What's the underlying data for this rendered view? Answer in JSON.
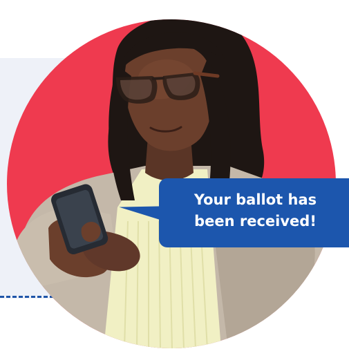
{
  "colors": {
    "accent_circle": "#ef3a4f",
    "speech_bubble": "#1c56ad",
    "panel": "#eef1f8",
    "dashed_line": "#1f55a8"
  },
  "speech_bubble": {
    "line1": "Your ballot has",
    "line2": "been received!"
  },
  "photo": {
    "subject": "woman-with-glasses-using-phone-photo"
  }
}
